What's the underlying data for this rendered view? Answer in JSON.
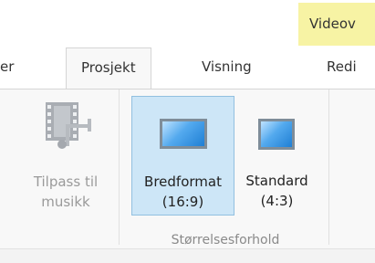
{
  "contextual_tab": {
    "label": "Videov"
  },
  "tabs": [
    {
      "label": "er"
    },
    {
      "label": "Prosjekt",
      "active": true
    },
    {
      "label": "Visning"
    },
    {
      "label": "Redi"
    }
  ],
  "ribbon": {
    "fit_to_music": {
      "line1": "Tilpass til",
      "line2": "musikk",
      "icon": "film-music-icon",
      "enabled": false
    },
    "aspect_group": {
      "label": "Størrelsesforhold",
      "buttons": [
        {
          "line1": "Bredformat",
          "line2": "(16:9)",
          "icon": "widescreen-icon",
          "selected": true
        },
        {
          "line1": "Standard",
          "line2": "(4:3)",
          "icon": "standard-screen-icon",
          "selected": false
        }
      ]
    }
  }
}
